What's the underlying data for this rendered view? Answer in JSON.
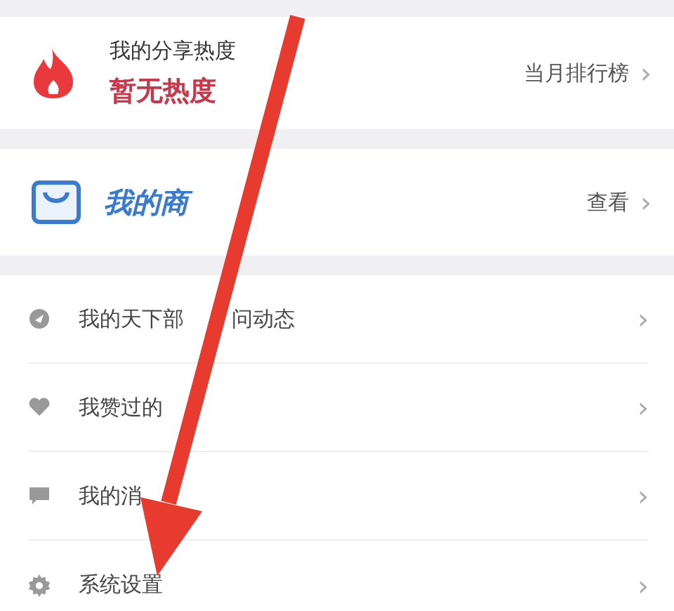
{
  "heat": {
    "label": "我的分享热度",
    "value": "暂无热度",
    "link": "当月排行榜",
    "chevron": "›"
  },
  "shop": {
    "title": "我的商",
    "link": "查看",
    "chevron": "›"
  },
  "menu": [
    {
      "kind": "dynamic",
      "label": "我的天下部",
      "label_tail": "问动态",
      "chevron": "›"
    },
    {
      "kind": "liked",
      "label": "我赞过的",
      "chevron": "›"
    },
    {
      "kind": "message",
      "label": "我的消",
      "chevron": "›"
    },
    {
      "kind": "settings",
      "label": "系统设置",
      "chevron": "›"
    }
  ]
}
